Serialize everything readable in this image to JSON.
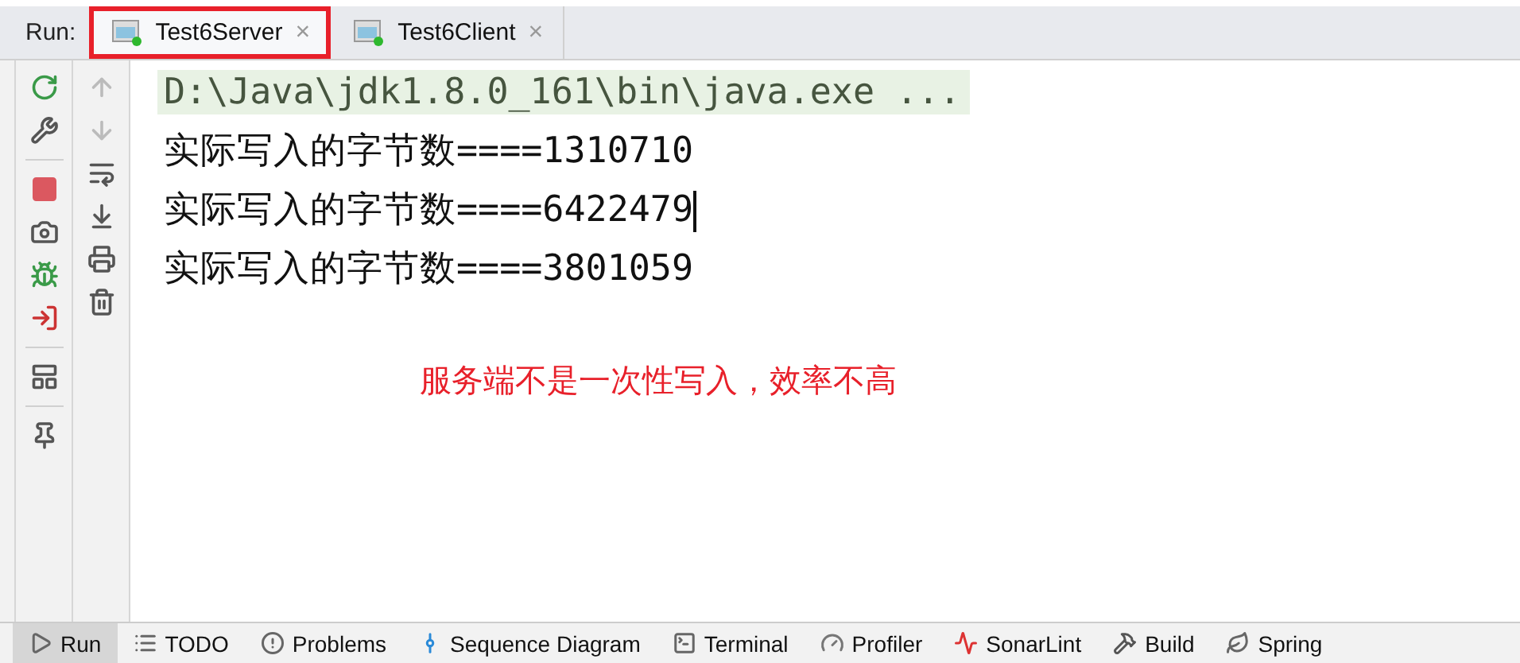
{
  "run_label": "Run:",
  "tabs": [
    {
      "label": "Test6Server",
      "selected": true,
      "highlighted": true,
      "close": "×"
    },
    {
      "label": "Test6Client",
      "selected": false,
      "highlighted": false,
      "close": "×"
    }
  ],
  "console": [
    {
      "kind": "command",
      "text": "D:\\Java\\jdk1.8.0_161\\bin\\java.exe ...",
      "caret": false
    },
    {
      "kind": "output",
      "text": "实际写入的字节数====1310710",
      "caret": false
    },
    {
      "kind": "output",
      "text": "实际写入的字节数====6422479",
      "caret": true
    },
    {
      "kind": "output",
      "text": "实际写入的字节数====3801059",
      "caret": false
    }
  ],
  "annotation": "服务端不是一次性写入，效率不高",
  "tool_windows": [
    {
      "kind": "run",
      "label": "Run",
      "selected": true
    },
    {
      "kind": "todo",
      "label": "TODO",
      "selected": false
    },
    {
      "kind": "problems",
      "label": "Problems",
      "selected": false
    },
    {
      "kind": "sequence",
      "label": "Sequence Diagram",
      "selected": false
    },
    {
      "kind": "terminal",
      "label": "Terminal",
      "selected": false
    },
    {
      "kind": "profiler",
      "label": "Profiler",
      "selected": false
    },
    {
      "kind": "sonar",
      "label": "SonarLint",
      "selected": false
    },
    {
      "kind": "build",
      "label": "Build",
      "selected": false
    },
    {
      "kind": "spring",
      "label": "Spring",
      "selected": false
    }
  ]
}
